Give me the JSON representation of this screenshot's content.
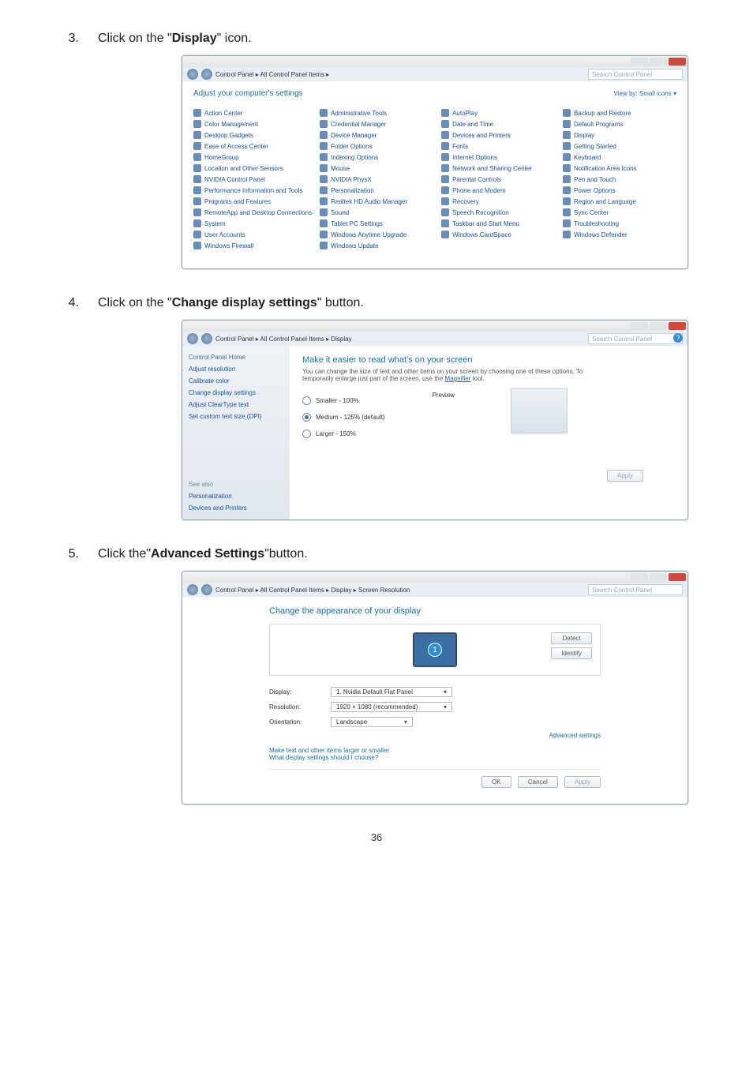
{
  "page_number": "36",
  "steps": {
    "s3": {
      "num": "3.",
      "pre": "Click on the \"",
      "bold": "Display",
      "post": "\" icon."
    },
    "s4": {
      "num": "4.",
      "pre": "Click on the \"",
      "bold": "Change display settings",
      "post": "\" button."
    },
    "s5": {
      "num": "5.",
      "pre": "Click the\"",
      "bold": "Advanced Settings",
      "post": "\"button."
    }
  },
  "shot1": {
    "breadcrumb": "Control Panel  ▸  All Control Panel Items  ▸",
    "search": "Search Control Panel",
    "heading": "Adjust your computer's settings",
    "viewby": "View by:  Small icons ▾",
    "items": [
      "Action Center",
      "Administrative Tools",
      "AutoPlay",
      "Backup and Restore",
      "Color Management",
      "Credential Manager",
      "Date and Time",
      "Default Programs",
      "Desktop Gadgets",
      "Device Manager",
      "Devices and Printers",
      "Display",
      "Ease of Access Center",
      "Folder Options",
      "Fonts",
      "Getting Started",
      "HomeGroup",
      "Indexing Options",
      "Internet Options",
      "Keyboard",
      "Location and Other Sensors",
      "Mouse",
      "Network and Sharing Center",
      "Notification Area Icons",
      "NVIDIA Control Panel",
      "NVIDIA PhysX",
      "Parental Controls",
      "Pen and Touch",
      "Performance Information and Tools",
      "Personalization",
      "Phone and Modem",
      "Power Options",
      "Programs and Features",
      "Realtek HD Audio Manager",
      "Recovery",
      "Region and Language",
      "RemoteApp and Desktop Connections",
      "Sound",
      "Speech Recognition",
      "Sync Center",
      "System",
      "Tablet PC Settings",
      "Taskbar and Start Menu",
      "Troubleshooting",
      "User Accounts",
      "Windows Anytime Upgrade",
      "Windows CardSpace",
      "Windows Defender",
      "Windows Firewall",
      "Windows Update"
    ]
  },
  "shot2": {
    "breadcrumb": "Control Panel  ▸  All Control Panel Items  ▸  Display",
    "search": "Search Control Panel",
    "sidebar": {
      "home": "Control Panel Home",
      "links": [
        "Adjust resolution",
        "Calibrate color",
        "Change display settings",
        "Adjust ClearType text",
        "Set custom text size (DPI)"
      ],
      "see_also_label": "See also",
      "see_also": [
        "Personalization",
        "Devices and Printers"
      ]
    },
    "heading": "Make it easier to read what's on your screen",
    "desc_a": "You can change the size of text and other items on your screen by choosing one of these options. To temporarily enlarge just part of the screen, use the ",
    "desc_link": "Magnifier",
    "desc_b": " tool.",
    "opts": {
      "small": "Smaller - 100%",
      "medium": "Medium - 125% (default)",
      "large": "Larger - 150%"
    },
    "preview_label": "Preview",
    "apply": "Apply"
  },
  "shot3": {
    "breadcrumb": "Control Panel  ▸  All Control Panel Items  ▸  Display  ▸  Screen Resolution",
    "search": "Search Control Panel",
    "heading": "Change the appearance of your display",
    "detect": "Detect",
    "identify": "Identify",
    "badge": "1",
    "kv": {
      "display_label": "Display:",
      "display_val": "1. Nvidia Default Flat Panel",
      "res_label": "Resolution:",
      "res_val": "1920 × 1080 (recommended)",
      "orient_label": "Orientation:",
      "orient_val": "Landscape"
    },
    "adv": "Advanced settings",
    "link1": "Make text and other items larger or smaller",
    "link2": "What display settings should I choose?",
    "ok": "OK",
    "cancel": "Cancel",
    "apply": "Apply"
  }
}
